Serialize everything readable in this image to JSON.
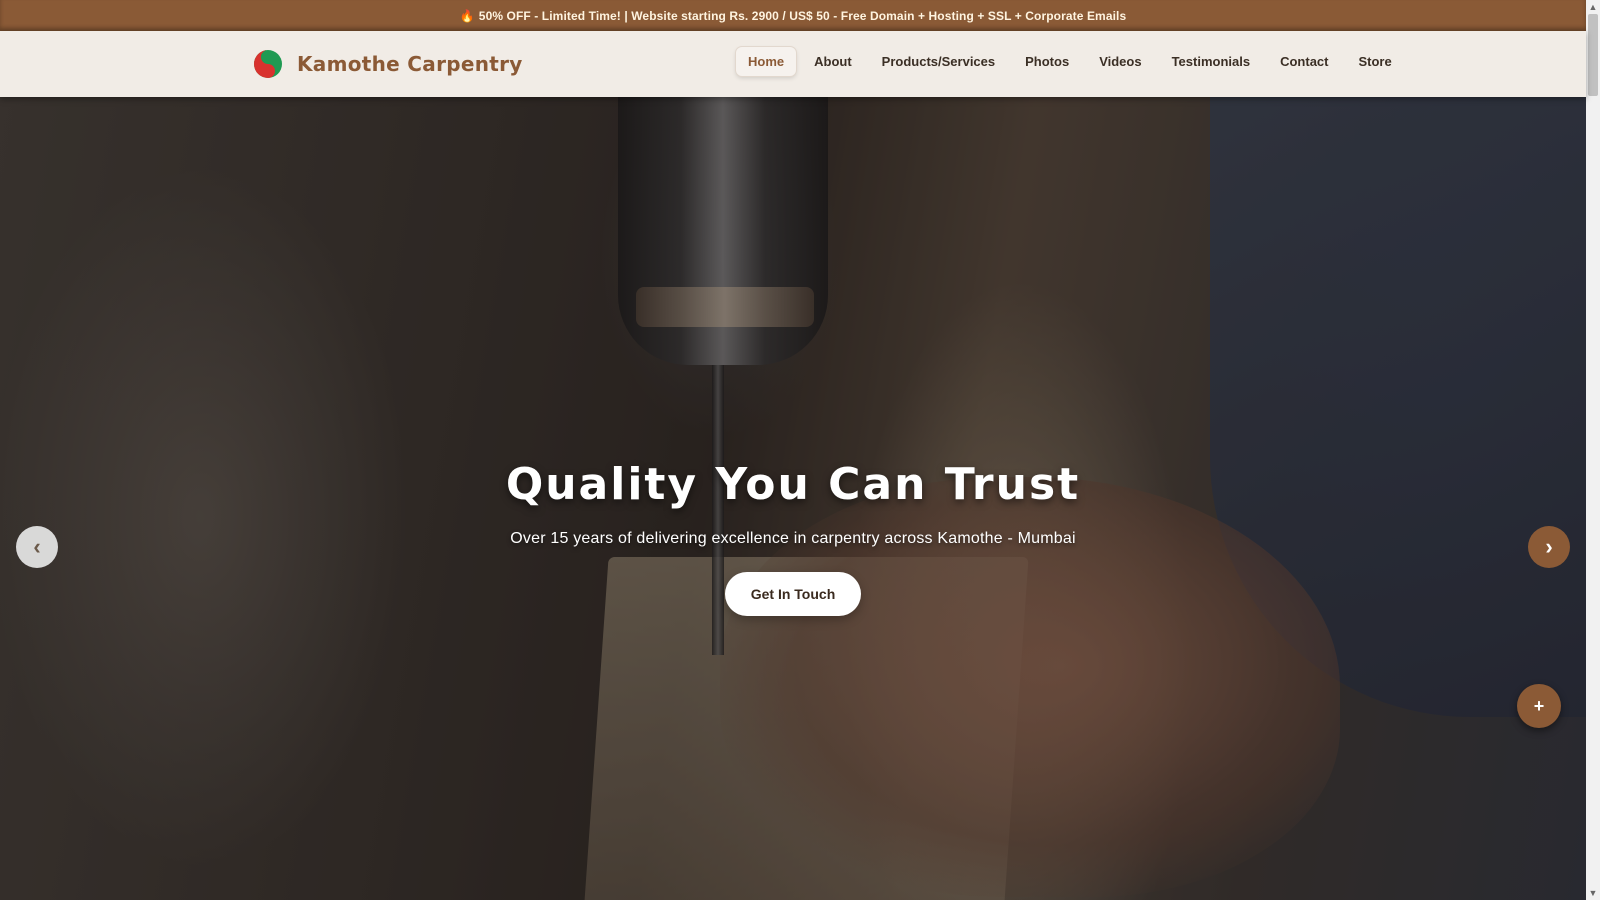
{
  "promo": {
    "icon": "flame-icon",
    "text": "50% OFF - Limited Time! | Website starting Rs. 2900 / US$ 50 - Free Domain + Hosting + SSL + Corporate Emails"
  },
  "header": {
    "brand_name": "Kamothe Carpentry",
    "nav": [
      {
        "label": "Home",
        "active": true
      },
      {
        "label": "About"
      },
      {
        "label": "Products/Services"
      },
      {
        "label": "Photos"
      },
      {
        "label": "Videos"
      },
      {
        "label": "Testimonials"
      },
      {
        "label": "Contact"
      },
      {
        "label": "Store"
      }
    ]
  },
  "hero": {
    "title": "Quality You Can Trust",
    "subtitle": "Over 15 years of delivering excellence in carpentry across Kamothe - Mumbai",
    "cta_label": "Get In Touch",
    "prev_symbol": "‹",
    "next_symbol": "›"
  },
  "fab": {
    "symbol": "+"
  },
  "scrollbar": {
    "up": "▲",
    "down": "▼"
  },
  "colors": {
    "brand": "#8b5a36",
    "promo_bg": "#8a5a36",
    "header_bg": "#f1ece6",
    "cta_bg": "#ffffff"
  }
}
